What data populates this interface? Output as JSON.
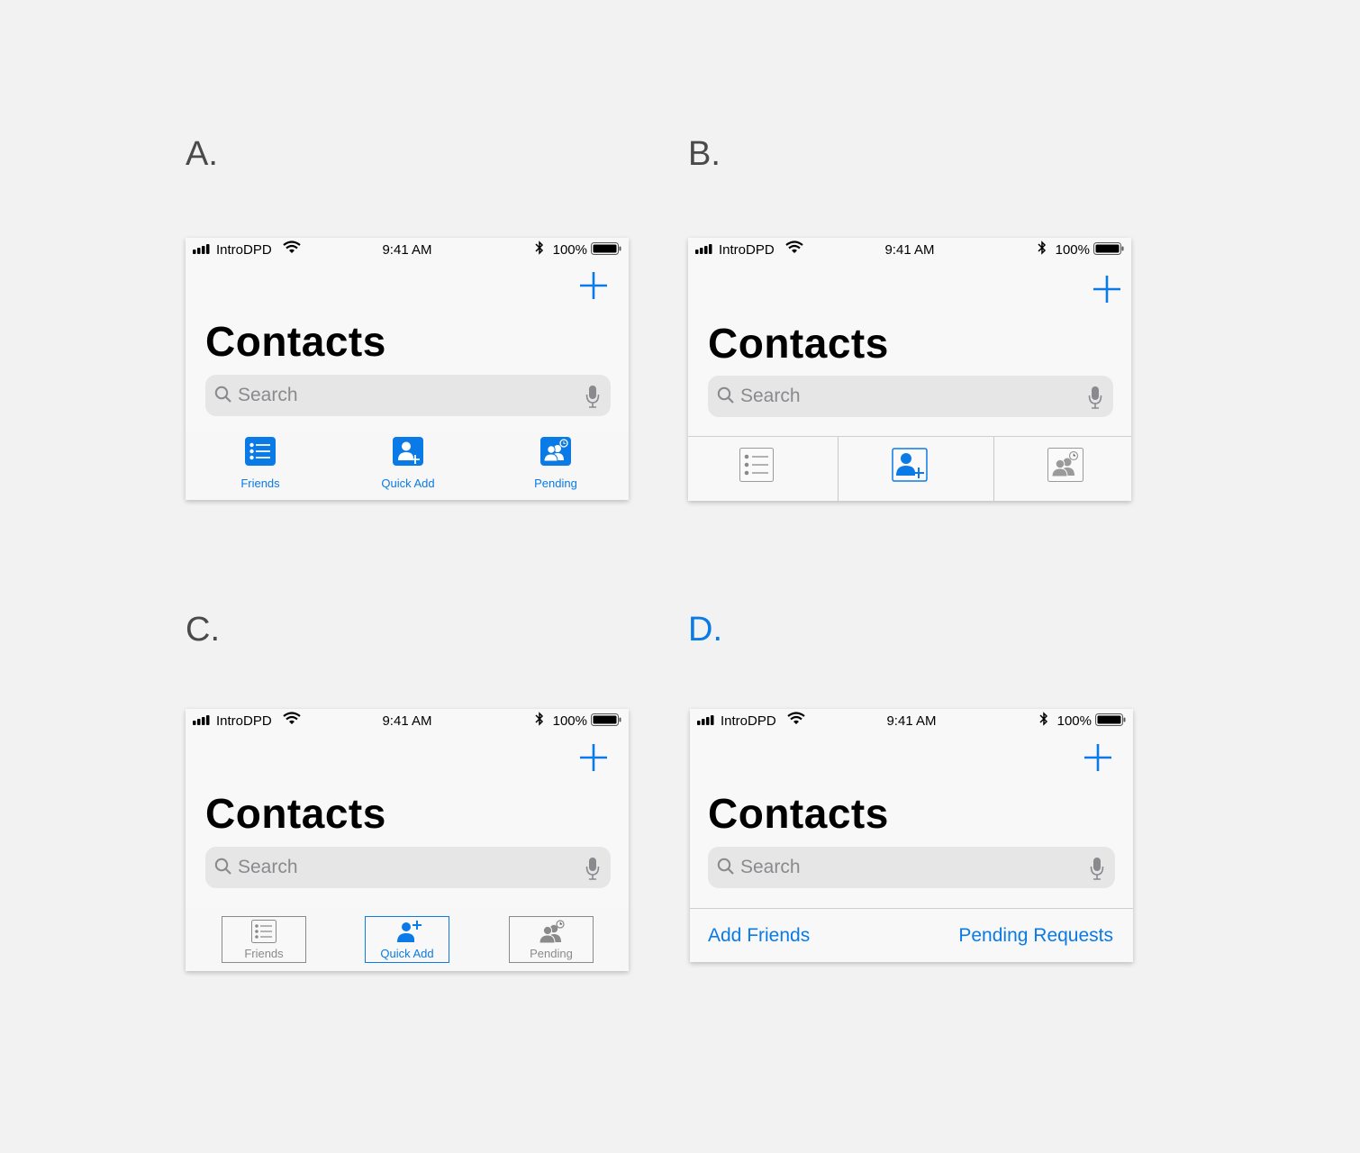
{
  "variants": [
    {
      "label": "A.",
      "status": {
        "carrier": "IntroDPD",
        "time": "9:41 AM",
        "battery": "100%"
      },
      "title": "Contacts",
      "search": {
        "placeholder": "Search"
      },
      "tabs": [
        {
          "label": "Friends",
          "icon": "list-icon"
        },
        {
          "label": "Quick Add",
          "icon": "add-person-icon"
        },
        {
          "label": "Pending",
          "icon": "pending-person-icon"
        }
      ]
    },
    {
      "label": "B.",
      "status": {
        "carrier": "IntroDPD",
        "time": "9:41 AM",
        "battery": "100%"
      },
      "title": "Contacts",
      "search": {
        "placeholder": "Search"
      },
      "tabs": [
        {
          "icon": "list-icon",
          "active": false
        },
        {
          "icon": "add-person-icon",
          "active": true
        },
        {
          "icon": "pending-person-icon",
          "active": false
        }
      ]
    },
    {
      "label": "C.",
      "status": {
        "carrier": "IntroDPD",
        "time": "9:41 AM",
        "battery": "100%"
      },
      "title": "Contacts",
      "search": {
        "placeholder": "Search"
      },
      "tabs": [
        {
          "label": "Friends",
          "icon": "list-icon",
          "active": false
        },
        {
          "label": "Quick Add",
          "icon": "add-person-icon",
          "active": true
        },
        {
          "label": "Pending",
          "icon": "pending-person-icon",
          "active": false
        }
      ]
    },
    {
      "label": "D.",
      "status": {
        "carrier": "IntroDPD",
        "time": "9:41 AM",
        "battery": "100%"
      },
      "title": "Contacts",
      "search": {
        "placeholder": "Search"
      },
      "links": {
        "left": "Add Friends",
        "right": "Pending Requests"
      }
    }
  ],
  "colors": {
    "accent": "#0a7ae6",
    "inactive": "#8a8a8a",
    "background": "#f2f2f2"
  }
}
